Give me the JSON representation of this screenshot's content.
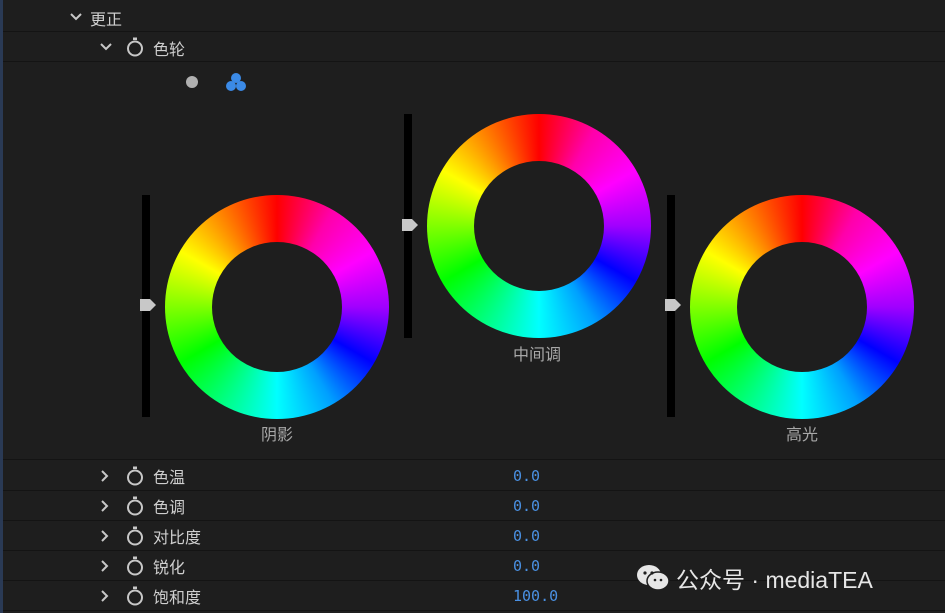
{
  "section": {
    "title": "更正"
  },
  "color_wheels": {
    "title": "色轮",
    "modes": [
      "single-wheel-icon",
      "three-wheels-icon"
    ],
    "wheels": [
      {
        "label": "阴影",
        "level": 0.5
      },
      {
        "label": "中间调",
        "level": 0.5
      },
      {
        "label": "高光",
        "level": 0.5
      }
    ]
  },
  "params": [
    {
      "label": "色温",
      "value": "0.0"
    },
    {
      "label": "色调",
      "value": "0.0"
    },
    {
      "label": "对比度",
      "value": "0.0"
    },
    {
      "label": "锐化",
      "value": "0.0"
    },
    {
      "label": "饱和度",
      "value": "100.0"
    }
  ],
  "watermark": {
    "text": "公众号 · mediaTEA"
  },
  "colors": {
    "value_blue": "#4a90e2",
    "active_mode": "#3b8ae6"
  }
}
